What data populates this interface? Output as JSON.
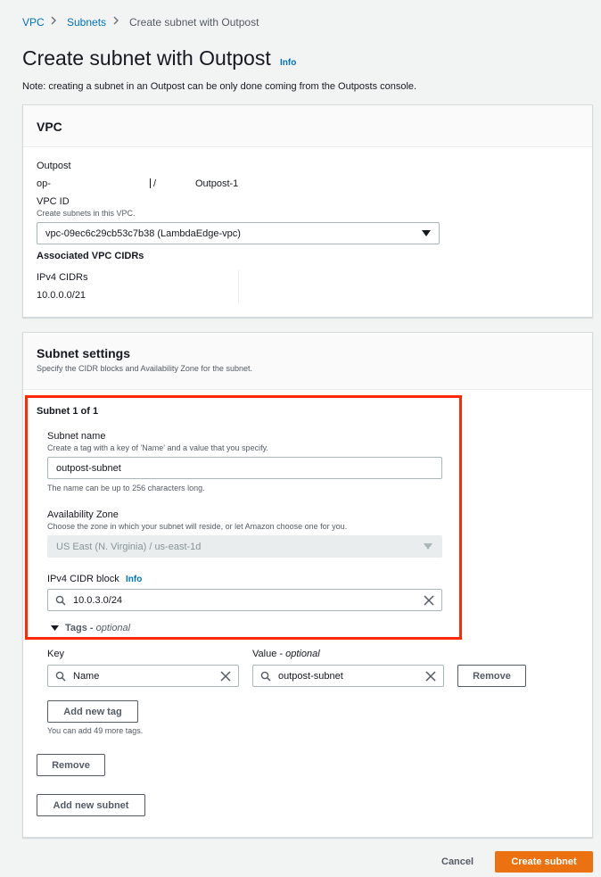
{
  "breadcrumb": {
    "items": [
      "VPC",
      "Subnets",
      "Create subnet with Outpost"
    ]
  },
  "page": {
    "title": "Create subnet with Outpost",
    "info_label": "Info",
    "note": "Note: creating a subnet in an Outpost can be only done coming from the Outposts console."
  },
  "vpc_card": {
    "title": "VPC",
    "outpost_label": "Outpost",
    "outpost_id_prefix": "op-",
    "outpost_separator": "/",
    "outpost_name": "Outpost-1",
    "vpc_id_label": "VPC ID",
    "vpc_id_desc": "Create subnets in this VPC.",
    "vpc_id_value": "vpc-09ec6c29cb53c7b38 (LambdaEdge-vpc)",
    "cidrs_heading": "Associated VPC CIDRs",
    "ipv4_cidrs_label": "IPv4 CIDRs",
    "ipv4_cidr_value": "10.0.0.0/21"
  },
  "subnet_settings": {
    "title": "Subnet settings",
    "desc": "Specify the CIDR blocks and Availability Zone for the subnet.",
    "subnet_heading": "Subnet 1 of 1",
    "name_label": "Subnet name",
    "name_desc": "Create a tag with a key of 'Name' and a value that you specify.",
    "name_value": "outpost-subnet",
    "name_hint": "The name can be up to 256 characters long.",
    "az_label": "Availability Zone",
    "az_desc": "Choose the zone in which your subnet will reside, or let Amazon choose one for you.",
    "az_value": "US East (N. Virginia) / us-east-1d",
    "cidr_label": "IPv4 CIDR block",
    "cidr_info": "Info",
    "cidr_value": "10.0.3.0/24",
    "tags_label": "Tags -",
    "tags_optional": "optional",
    "key_label": "Key",
    "value_label": "Value -",
    "value_optional": "optional",
    "tag_key_value": "Name",
    "tag_value_value": "outpost-subnet",
    "remove_tag_button": "Remove",
    "add_tag_button": "Add new tag",
    "tags_hint": "You can add 49 more tags.",
    "remove_subnet_button": "Remove",
    "add_subnet_button": "Add new subnet"
  },
  "footer": {
    "cancel_button": "Cancel",
    "create_button": "Create subnet"
  },
  "colors": {
    "link": "#0073bb",
    "primary": "#ec7211",
    "highlight": "#ff2a00"
  }
}
